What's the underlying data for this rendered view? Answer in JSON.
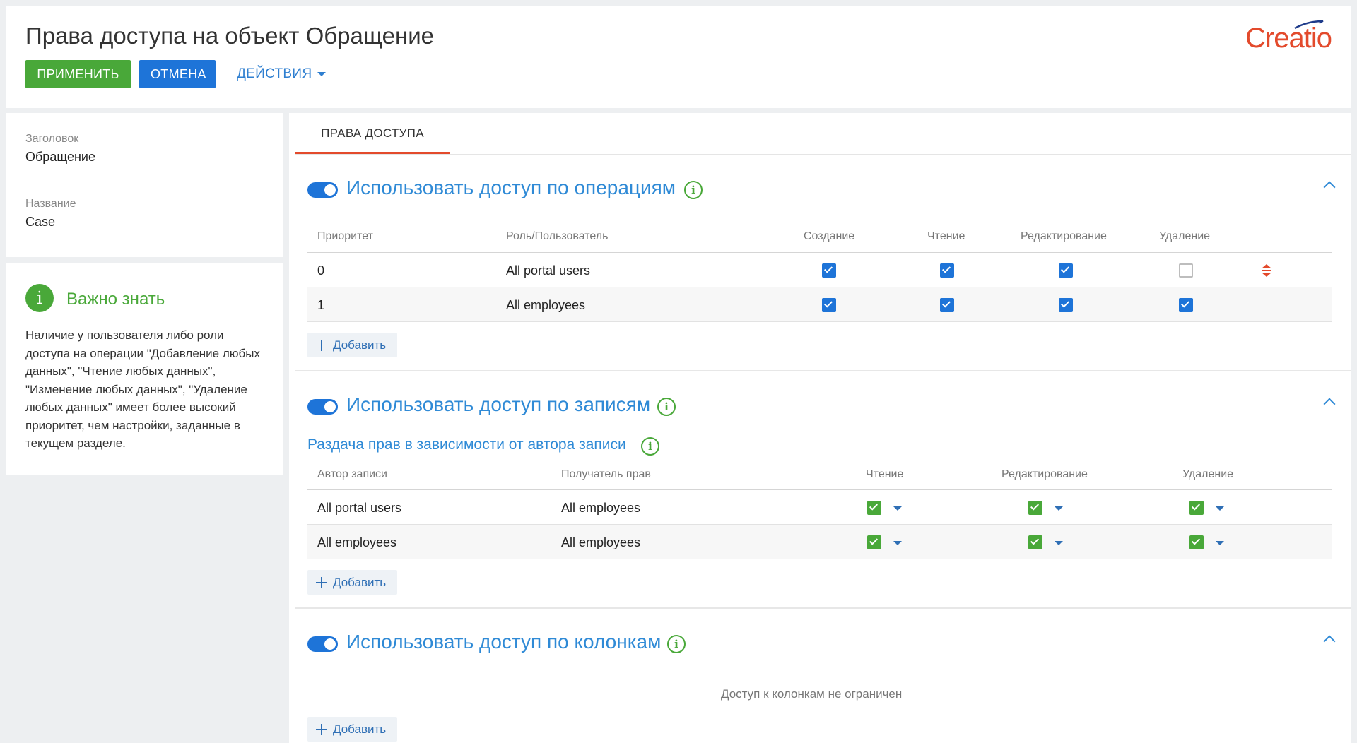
{
  "header": {
    "title": "Права доступа на объект Обращение",
    "apply_label": "ПРИМЕНИТЬ",
    "cancel_label": "ОТМЕНА",
    "actions_label": "ДЕЙСТВИЯ",
    "logo_text": "Creatio"
  },
  "fields": {
    "caption_label": "Заголовок",
    "caption_value": "Обращение",
    "name_label": "Название",
    "name_value": "Case"
  },
  "info": {
    "title": "Важно знать",
    "text": "Наличие у пользователя либо роли доступа на операции \"Добавление любых данных\", \"Чтение любых данных\", \"Изменение любых данных\", \"Удаление любых данных\" имеет более высокий приоритет, чем настройки, заданные в текущем разделе."
  },
  "tabs": [
    {
      "label": "ПРАВА ДОСТУПА",
      "active": true
    }
  ],
  "operations": {
    "title": "Использовать доступ по операциям",
    "enabled": true,
    "columns": [
      "Приоритет",
      "Роль/Пользователь",
      "Создание",
      "Чтение",
      "Редактирование",
      "Удаление"
    ],
    "rows": [
      {
        "priority": "0",
        "role": "All portal users",
        "create": true,
        "read": true,
        "edit": true,
        "delete": false
      },
      {
        "priority": "1",
        "role": "All employees",
        "create": true,
        "read": true,
        "edit": true,
        "delete": true
      }
    ],
    "add_label": "Добавить"
  },
  "records": {
    "title": "Использовать доступ по записям",
    "enabled": true,
    "subtitle": "Раздача прав в зависимости от автора записи",
    "columns": [
      "Автор записи",
      "Получатель прав",
      "Чтение",
      "Редактирование",
      "Удаление"
    ],
    "rows": [
      {
        "author": "All portal users",
        "grantee": "All employees",
        "read": true,
        "edit": true,
        "delete": true
      },
      {
        "author": "All employees",
        "grantee": "All employees",
        "read": true,
        "edit": true,
        "delete": true
      }
    ],
    "add_label": "Добавить"
  },
  "columns_access": {
    "title": "Использовать доступ по колонкам",
    "enabled": true,
    "empty_text": "Доступ к колонкам не ограничен",
    "add_label": "Добавить"
  },
  "colors": {
    "apply": "#49a839",
    "primary": "#1e74d8",
    "accent": "#e34a2c",
    "link": "#2f8ad6",
    "success": "#49a839"
  }
}
